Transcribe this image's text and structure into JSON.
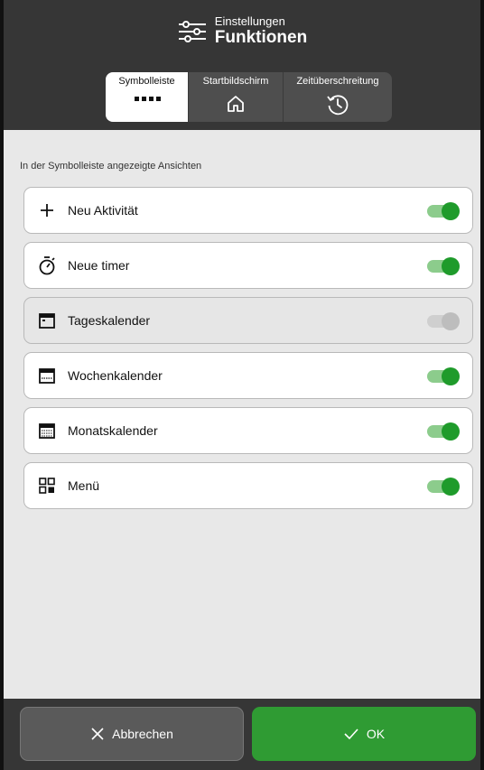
{
  "header": {
    "subtitle": "Einstellungen",
    "title": "Funktionen",
    "icon": "sliders-icon"
  },
  "tabs": [
    {
      "label": "Symbolleiste",
      "icon": "toolbar-dots-icon",
      "active": true
    },
    {
      "label": "Startbildschirm",
      "icon": "home-icon",
      "active": false
    },
    {
      "label": "Zeitüberschreitung",
      "icon": "history-icon",
      "active": false
    }
  ],
  "section": {
    "label": "In der Symbolleiste angezeigte Ansichten"
  },
  "items": [
    {
      "label": "Neu Aktivität",
      "icon": "plus-icon",
      "enabled": true
    },
    {
      "label": "Neue timer",
      "icon": "stopwatch-icon",
      "enabled": true
    },
    {
      "label": "Tageskalender",
      "icon": "day-calendar-icon",
      "enabled": false
    },
    {
      "label": "Wochenkalender",
      "icon": "week-calendar-icon",
      "enabled": true
    },
    {
      "label": "Monatskalender",
      "icon": "month-calendar-icon",
      "enabled": true
    },
    {
      "label": "Menü",
      "icon": "menu-grid-icon",
      "enabled": true
    }
  ],
  "footer": {
    "cancel_label": "Abbrechen",
    "ok_label": "OK"
  },
  "colors": {
    "header_bg": "#363636",
    "accent_green": "#2f9b33",
    "toggle_on": "#1f9b2b",
    "content_bg": "#e8e8e8"
  }
}
